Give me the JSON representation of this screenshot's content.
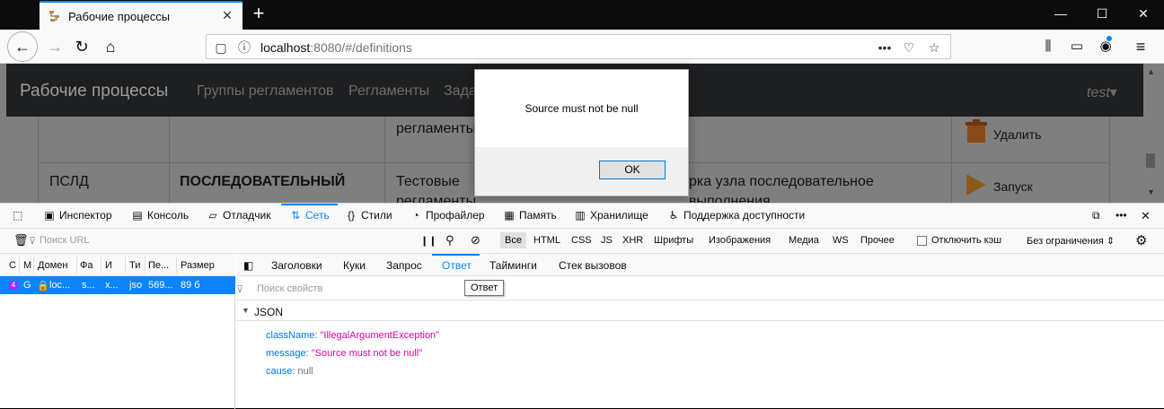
{
  "browser": {
    "tab_title": "Рабочие процессы",
    "url_host": "localhost",
    "url_rest": ":8080/#/definitions"
  },
  "app": {
    "brand": "Рабочие процессы",
    "nav": [
      "Группы регламентов",
      "Регламенты",
      "Зада"
    ],
    "user": "test",
    "table": {
      "row1": {
        "c3": "регламенты",
        "action": "Удалить"
      },
      "row2": {
        "c1": "ПСЛД",
        "c2": "ПОСЛЕДОВАТЕЛЬНЫЙ",
        "c3": "Тестовые",
        "c3b": "регламенты",
        "c4": "рка узла последовательное",
        "c4b": "выполнения",
        "action": "Запуск"
      }
    }
  },
  "dialog": {
    "message": "Source must not be null",
    "ok_label": "OK"
  },
  "devtools": {
    "tabs": [
      "Инспектор",
      "Консоль",
      "Отладчик",
      "Сеть",
      "Стили",
      "Профайлер",
      "Память",
      "Хранилище",
      "Поддержка доступности"
    ],
    "active_tab": "Сеть",
    "filter_placeholder": "Поиск URL",
    "type_filters": [
      "Все",
      "HTML",
      "CSS",
      "JS",
      "XHR",
      "Шрифты",
      "Изображения",
      "Медиа",
      "WS",
      "Прочее"
    ],
    "disable_cache_label": "Отключить кэш",
    "throttle_label": "Без ограничения ⇕",
    "columns": [
      "С",
      "М",
      "Домен",
      "Фа",
      "И",
      "Ти",
      "Пе...",
      "Размер"
    ],
    "request_row": {
      "status": "4",
      "method": "G",
      "domain": "loc...",
      "file": "s...",
      "initiator": "x...",
      "type": "jso",
      "transferred": "569...",
      "size": "89 б"
    },
    "detail_tabs": [
      "Заголовки",
      "Куки",
      "Запрос",
      "Ответ",
      "Тайминги",
      "Стек вызовов"
    ],
    "active_detail_tab": "Ответ",
    "tooltip": "Ответ",
    "prop_search_placeholder": "Поиск свойств",
    "json_label": "JSON",
    "json": [
      {
        "key": "className:",
        "value": "\"IllegalArgumentException\"",
        "kind": "str"
      },
      {
        "key": "message:",
        "value": "\"Source must not be null\"",
        "kind": "str"
      },
      {
        "key": "cause:",
        "value": "null",
        "kind": "null"
      }
    ]
  }
}
